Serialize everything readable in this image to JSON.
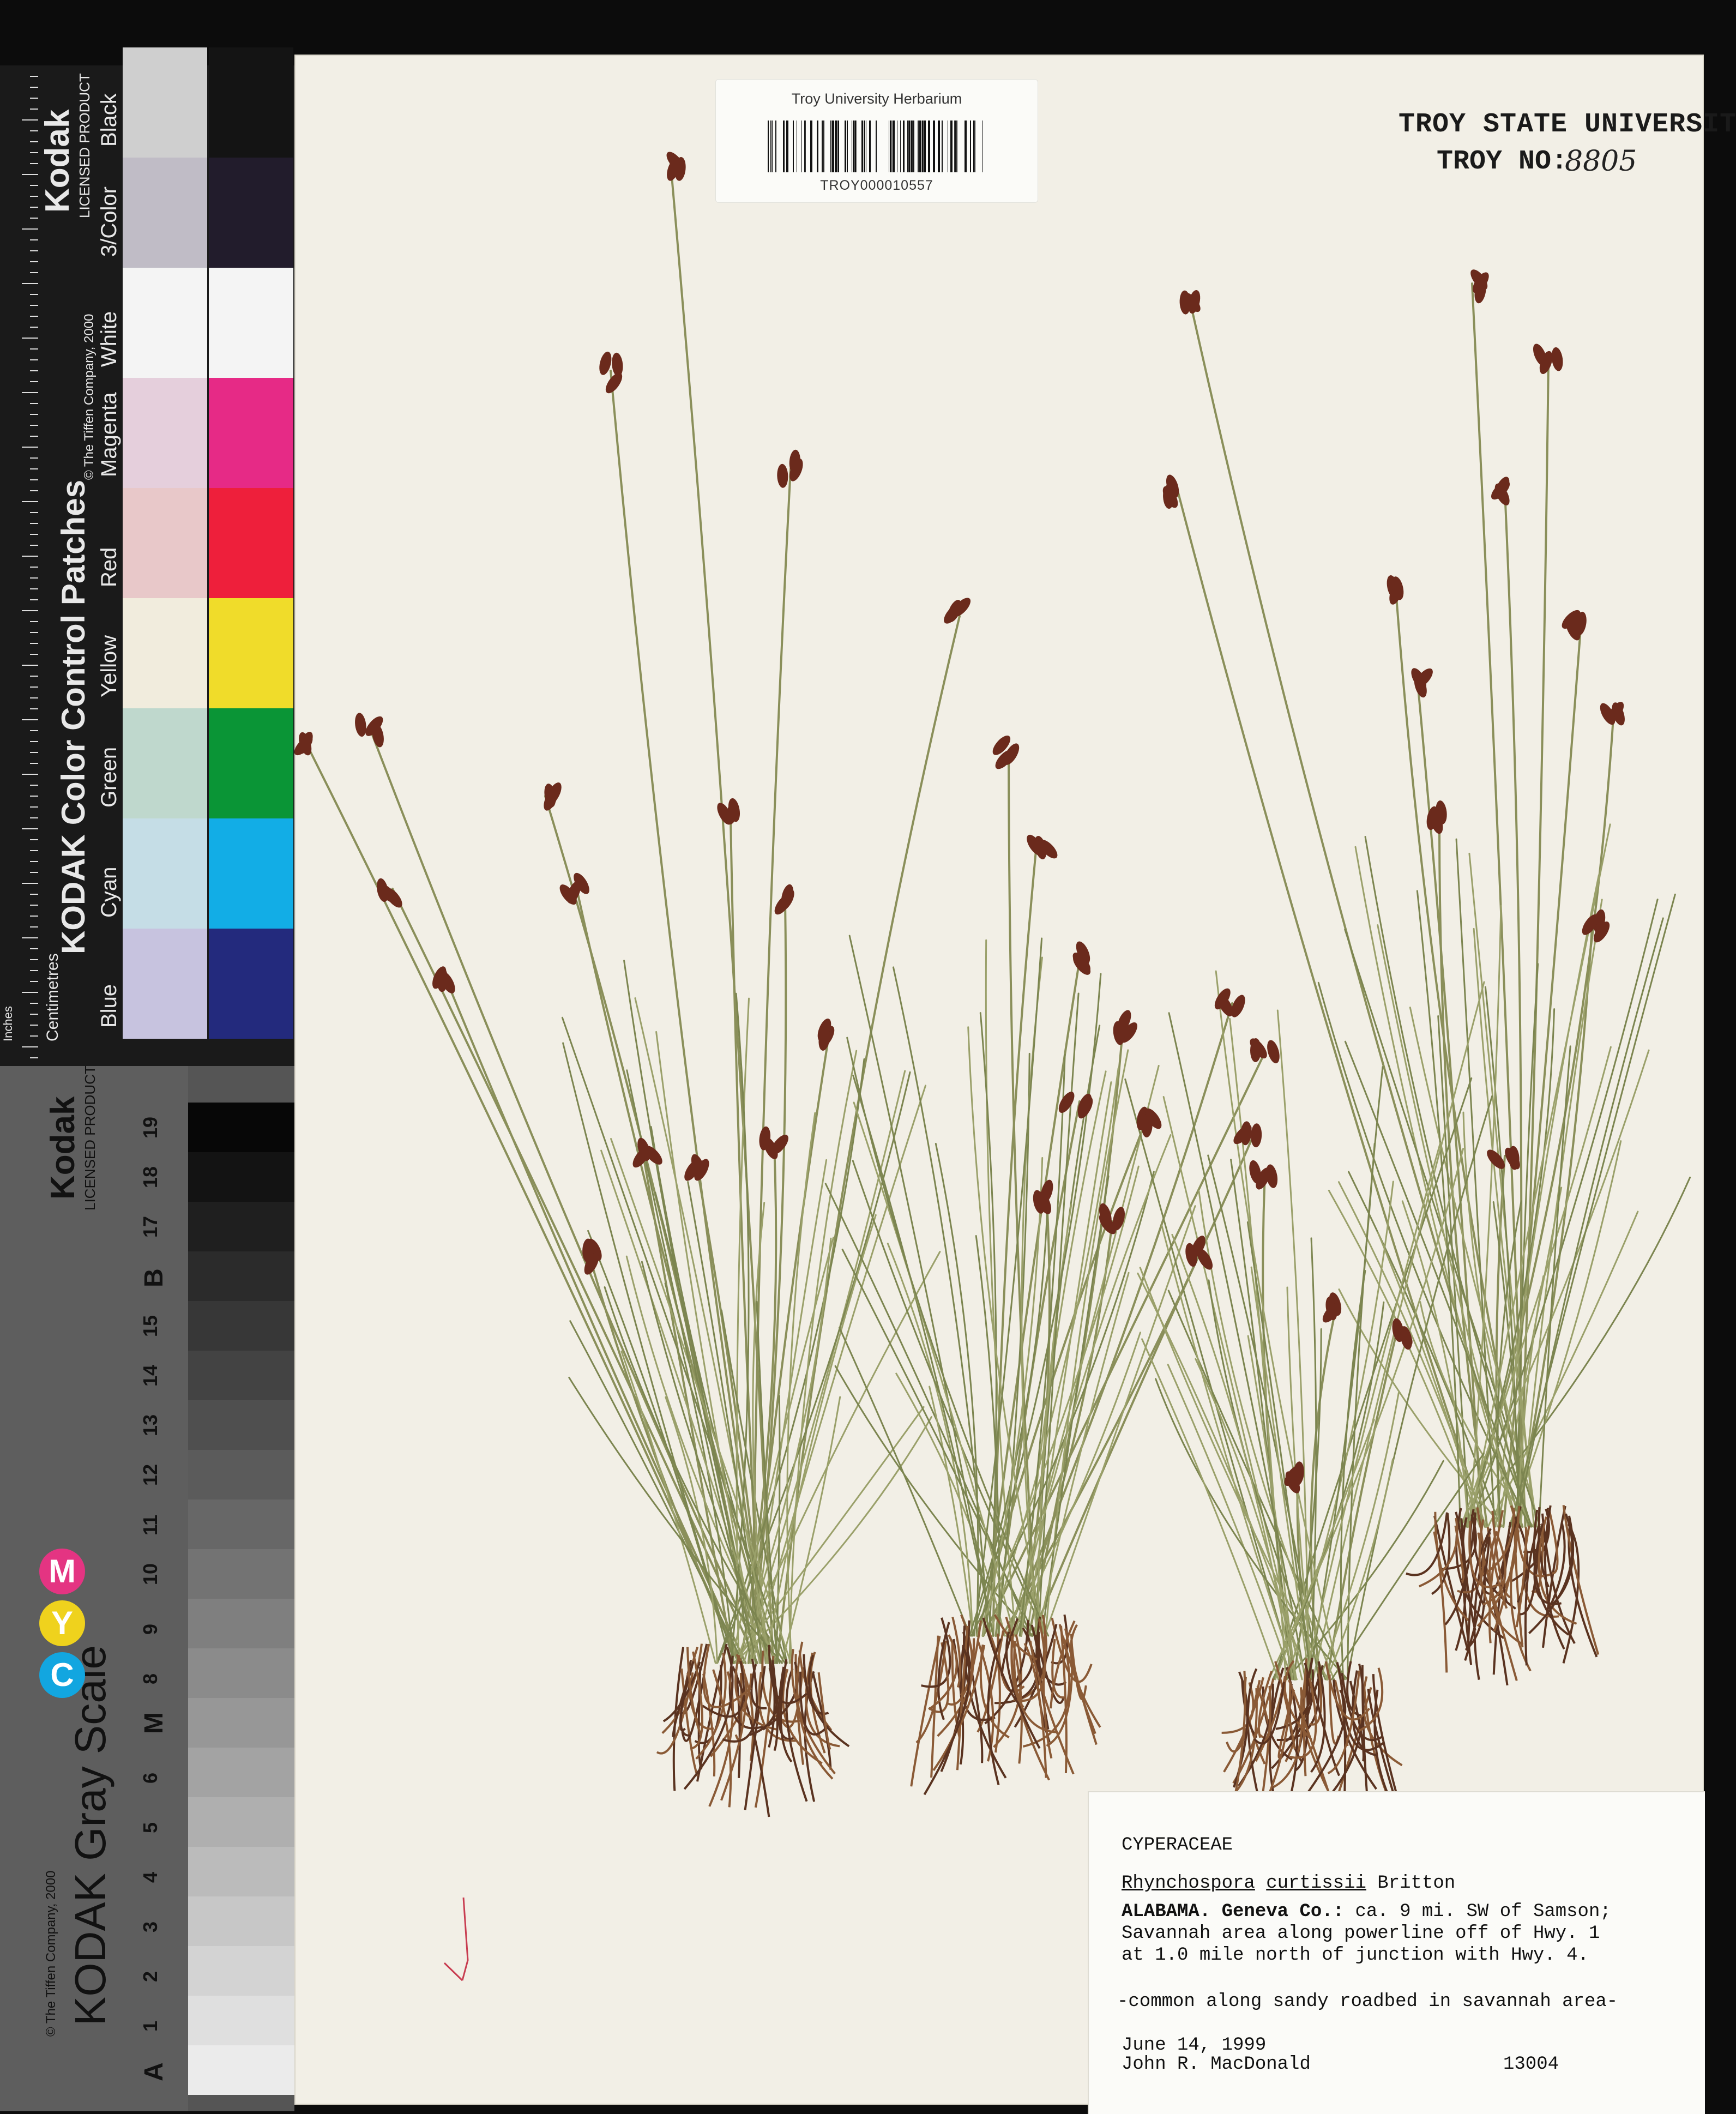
{
  "barcode_label": {
    "institution": "Troy University Herbarium",
    "catalog_number": "TROY000010557"
  },
  "stamp": {
    "university": "TROY STATE UNIVERSITY",
    "number_prefix": "TROY NO:",
    "number_value": "8805"
  },
  "specimen_label": {
    "family": "CYPERACEAE",
    "genus": "Rhynchospora",
    "species": "curtissii",
    "author": "Britton",
    "locality_state_county": "ALABAMA. Geneva Co.:",
    "locality_line1": "ca. 9 mi. SW of Samson;",
    "locality_line2": "Savannah area along powerline off of Hwy. 1",
    "locality_line3": "at 1.0 mile north of junction with Hwy. 4.",
    "habitat": "-common along sandy roadbed in savannah area-",
    "date": "June 14, 1999",
    "collector": "John R. MacDonald",
    "collection_number": "13004"
  },
  "color_checker": {
    "brand": "Kodak",
    "licensed": "LICENSED PRODUCT",
    "title": "KODAK Color Control Patches",
    "copyright": "© The Tiffen Company, 2000",
    "units_cm": "Centimetres",
    "units_in": "Inches",
    "patch_labels": [
      "Blue",
      "Cyan",
      "Green",
      "Yellow",
      "Red",
      "Magenta",
      "White",
      "3/Color",
      "Black"
    ],
    "patches": [
      {
        "light": "#c7c3df",
        "dark": "#232a7d"
      },
      {
        "light": "#c5dde6",
        "dark": "#12ade6"
      },
      {
        "light": "#bfd8cd",
        "dark": "#0a9536"
      },
      {
        "light": "#f1ecdd",
        "dark": "#f0dc2a"
      },
      {
        "light": "#e8c8c9",
        "dark": "#ee1f3b"
      },
      {
        "light": "#e5cfdc",
        "dark": "#e62a86"
      },
      {
        "light": "#f4f4f4",
        "dark": "#f4f4f4"
      },
      {
        "light": "#c0bcc6",
        "dark": "#221c2c"
      },
      {
        "light": "#cfcfcf",
        "dark": "#141414"
      }
    ]
  },
  "gray_scale": {
    "brand": "Kodak",
    "licensed": "LICENSED PRODUCT",
    "title": "KODAK Gray Scale",
    "copyright": "© The Tiffen Company, 2000",
    "cmy": [
      "C",
      "Y",
      "M"
    ],
    "scale_labels": [
      "A",
      "1",
      "2",
      "3",
      "4",
      "5",
      "6",
      "M",
      "8",
      "9",
      "10",
      "11",
      "12",
      "13",
      "14",
      "15",
      "B",
      "17",
      "18",
      "19"
    ]
  }
}
